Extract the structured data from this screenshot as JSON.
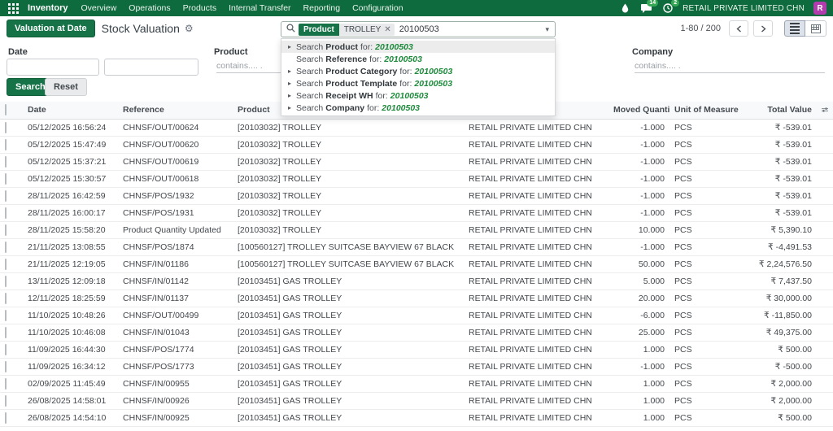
{
  "colors": {
    "accent_green": "#0e6b3d",
    "button_green": "#157347",
    "match_green": "#1e8a3c",
    "avatar_purple": "#b23bad",
    "badge_green": "#36a855"
  },
  "topbar": {
    "app_name": "Inventory",
    "menus": [
      "Overview",
      "Operations",
      "Products",
      "Internal Transfer",
      "Reporting",
      "Configuration"
    ],
    "message_badge": "14",
    "activity_badge": "2",
    "company": "RETAIL PRIVATE LIMITED CHN",
    "avatar_initial": "R"
  },
  "control": {
    "action_button": "Valuation at Date",
    "title": "Stock Valuation",
    "pager": "1-80 / 200"
  },
  "search": {
    "facet_category": "Product",
    "facet_value": "TROLLEY",
    "query": "20100503",
    "item_prefix": "Search",
    "item_for": "for:",
    "dropdown": [
      {
        "field": "Product",
        "value": "20100503",
        "expandable": true,
        "highlighted": true
      },
      {
        "field": "Reference",
        "value": "20100503",
        "expandable": false,
        "highlighted": false
      },
      {
        "field": "Product Category",
        "value": "20100503",
        "expandable": true,
        "highlighted": false
      },
      {
        "field": "Product Template",
        "value": "20100503",
        "expandable": true,
        "highlighted": false
      },
      {
        "field": "Receipt WH",
        "value": "20100503",
        "expandable": true,
        "highlighted": false
      },
      {
        "field": "Company",
        "value": "20100503",
        "expandable": true,
        "highlighted": false
      }
    ]
  },
  "filters": {
    "date_label": "Date",
    "product_label": "Product",
    "product_placeholder": "contains.... .",
    "company_label": "Company",
    "company_placeholder": "contains.... .",
    "search_button": "Search",
    "reset_button": "Reset"
  },
  "table": {
    "headers": {
      "date": "Date",
      "reference": "Reference",
      "product": "Product",
      "company": "",
      "qty": "Moved Quantity",
      "uom": "Unit of Measure",
      "total": "Total Value"
    },
    "rows": [
      {
        "date": "05/12/2025 16:56:24",
        "reference": "CHNSF/OUT/00624",
        "product": "[20103032] TROLLEY",
        "company": "RETAIL PRIVATE LIMITED CHN",
        "qty": "-1.000",
        "uom": "PCS",
        "total": "₹ -539.01"
      },
      {
        "date": "05/12/2025 15:47:49",
        "reference": "CHNSF/OUT/00620",
        "product": "[20103032] TROLLEY",
        "company": "RETAIL PRIVATE LIMITED CHN",
        "qty": "-1.000",
        "uom": "PCS",
        "total": "₹ -539.01"
      },
      {
        "date": "05/12/2025 15:37:21",
        "reference": "CHNSF/OUT/00619",
        "product": "[20103032] TROLLEY",
        "company": "RETAIL PRIVATE LIMITED CHN",
        "qty": "-1.000",
        "uom": "PCS",
        "total": "₹ -539.01"
      },
      {
        "date": "05/12/2025 15:30:57",
        "reference": "CHNSF/OUT/00618",
        "product": "[20103032] TROLLEY",
        "company": "RETAIL PRIVATE LIMITED CHN",
        "qty": "-1.000",
        "uom": "PCS",
        "total": "₹ -539.01"
      },
      {
        "date": "28/11/2025 16:42:59",
        "reference": "CHNSF/POS/1932",
        "product": "[20103032] TROLLEY",
        "company": "RETAIL PRIVATE LIMITED CHN",
        "qty": "-1.000",
        "uom": "PCS",
        "total": "₹ -539.01"
      },
      {
        "date": "28/11/2025 16:00:17",
        "reference": "CHNSF/POS/1931",
        "product": "[20103032] TROLLEY",
        "company": "RETAIL PRIVATE LIMITED CHN",
        "qty": "-1.000",
        "uom": "PCS",
        "total": "₹ -539.01"
      },
      {
        "date": "28/11/2025 15:58:20",
        "reference": "Product Quantity Updated",
        "product": "[20103032] TROLLEY",
        "company": "RETAIL PRIVATE LIMITED CHN",
        "qty": "10.000",
        "uom": "PCS",
        "total": "₹ 5,390.10"
      },
      {
        "date": "21/11/2025 13:08:55",
        "reference": "CHNSF/POS/1874",
        "product": "[100560127] TROLLEY SUITCASE BAYVIEW 67 BLACK",
        "company": "RETAIL PRIVATE LIMITED CHN",
        "qty": "-1.000",
        "uom": "PCS",
        "total": "₹ -4,491.53"
      },
      {
        "date": "21/11/2025 12:19:05",
        "reference": "CHNSF/IN/01186",
        "product": "[100560127] TROLLEY SUITCASE BAYVIEW 67 BLACK",
        "company": "RETAIL PRIVATE LIMITED CHN",
        "qty": "50.000",
        "uom": "PCS",
        "total": "₹ 2,24,576.50"
      },
      {
        "date": "13/11/2025 12:09:18",
        "reference": "CHNSF/IN/01142",
        "product": "[20103451] GAS TROLLEY",
        "company": "RETAIL PRIVATE LIMITED CHN",
        "qty": "5.000",
        "uom": "PCS",
        "total": "₹ 7,437.50"
      },
      {
        "date": "12/11/2025 18:25:59",
        "reference": "CHNSF/IN/01137",
        "product": "[20103451] GAS TROLLEY",
        "company": "RETAIL PRIVATE LIMITED CHN",
        "qty": "20.000",
        "uom": "PCS",
        "total": "₹ 30,000.00"
      },
      {
        "date": "11/10/2025 10:48:26",
        "reference": "CHNSF/OUT/00499",
        "product": "[20103451] GAS TROLLEY",
        "company": "RETAIL PRIVATE LIMITED CHN",
        "qty": "-6.000",
        "uom": "PCS",
        "total": "₹ -11,850.00"
      },
      {
        "date": "11/10/2025 10:46:08",
        "reference": "CHNSF/IN/01043",
        "product": "[20103451] GAS TROLLEY",
        "company": "RETAIL PRIVATE LIMITED CHN",
        "qty": "25.000",
        "uom": "PCS",
        "total": "₹ 49,375.00"
      },
      {
        "date": "11/09/2025 16:44:30",
        "reference": "CHNSF/POS/1774",
        "product": "[20103451] GAS TROLLEY",
        "company": "RETAIL PRIVATE LIMITED CHN",
        "qty": "1.000",
        "uom": "PCS",
        "total": "₹ 500.00"
      },
      {
        "date": "11/09/2025 16:34:12",
        "reference": "CHNSF/POS/1773",
        "product": "[20103451] GAS TROLLEY",
        "company": "RETAIL PRIVATE LIMITED CHN",
        "qty": "-1.000",
        "uom": "PCS",
        "total": "₹ -500.00"
      },
      {
        "date": "02/09/2025 11:45:49",
        "reference": "CHNSF/IN/00955",
        "product": "[20103451] GAS TROLLEY",
        "company": "RETAIL PRIVATE LIMITED CHN",
        "qty": "1.000",
        "uom": "PCS",
        "total": "₹ 2,000.00"
      },
      {
        "date": "26/08/2025 14:58:01",
        "reference": "CHNSF/IN/00926",
        "product": "[20103451] GAS TROLLEY",
        "company": "RETAIL PRIVATE LIMITED CHN",
        "qty": "1.000",
        "uom": "PCS",
        "total": "₹ 2,000.00"
      },
      {
        "date": "26/08/2025 14:54:10",
        "reference": "CHNSF/IN/00925",
        "product": "[20103451] GAS TROLLEY",
        "company": "RETAIL PRIVATE LIMITED CHN",
        "qty": "1.000",
        "uom": "PCS",
        "total": "₹ 500.00"
      }
    ]
  }
}
